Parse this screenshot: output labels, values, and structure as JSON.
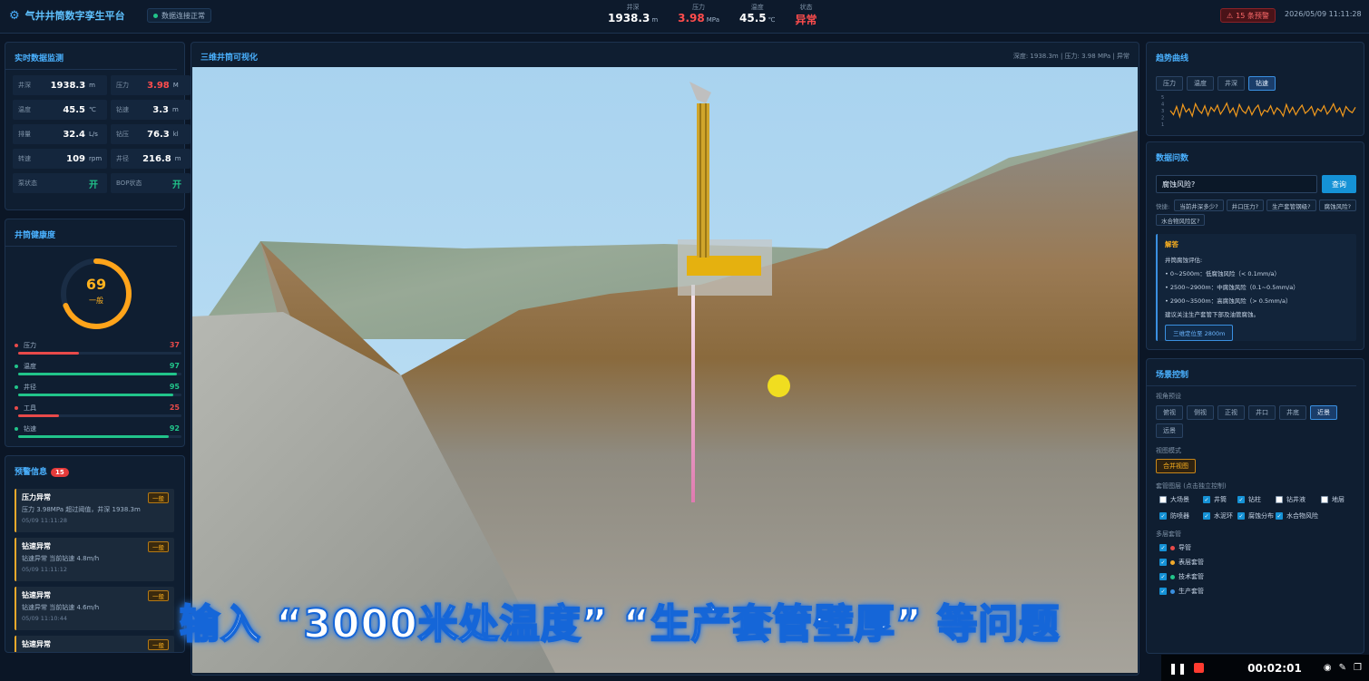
{
  "header": {
    "title": "气井井筒数字孪生平台",
    "connection": "数据连接正常",
    "metrics": [
      {
        "label": "井深",
        "value": "1938.3",
        "unit": "m"
      },
      {
        "label": "压力",
        "value": "3.98",
        "unit": "MPa"
      },
      {
        "label": "温度",
        "value": "45.5",
        "unit": "℃"
      },
      {
        "label": "状态",
        "value": "异常",
        "unit": ""
      }
    ],
    "alarm": "15 条预警",
    "datetime": "2026/05/09 11:11:28"
  },
  "realtime": {
    "title": "实时数据监测",
    "cells": [
      {
        "label": "井深",
        "value": "1938.3",
        "unit": "m"
      },
      {
        "label": "压力",
        "value": "3.98",
        "unit": "M"
      },
      {
        "label": "温度",
        "value": "45.5",
        "unit": "℃"
      },
      {
        "label": "钻速",
        "value": "3.3",
        "unit": "m"
      },
      {
        "label": "排量",
        "value": "32.4",
        "unit": "L/s"
      },
      {
        "label": "钻压",
        "value": "76.3",
        "unit": "kl"
      },
      {
        "label": "转速",
        "value": "109",
        "unit": "rpm"
      },
      {
        "label": "井径",
        "value": "216.8",
        "unit": "m"
      },
      {
        "label": "泵状态",
        "value": "开",
        "unit": ""
      },
      {
        "label": "BOP状态",
        "value": "开",
        "unit": ""
      }
    ]
  },
  "health": {
    "title": "井筒健康度",
    "score": "69",
    "score_fraction": 0.69,
    "level": "一般",
    "items": [
      {
        "name": "压力",
        "value": "37",
        "fraction": 0.37,
        "color": "#e84a4a"
      },
      {
        "name": "温度",
        "value": "97",
        "fraction": 0.97,
        "color": "#21c48a"
      },
      {
        "name": "井径",
        "value": "95",
        "fraction": 0.95,
        "color": "#21c48a"
      },
      {
        "name": "工具",
        "value": "25",
        "fraction": 0.25,
        "color": "#e84a4a"
      },
      {
        "name": "钻速",
        "value": "92",
        "fraction": 0.92,
        "color": "#21c48a"
      }
    ]
  },
  "alerts": {
    "title": "预警信息",
    "count": "15",
    "items": [
      {
        "title": "压力异常",
        "level": "一般",
        "desc": "压力 3.98MPa 超过阈值，井深 1938.3m",
        "time": "05/09 11:11:28"
      },
      {
        "title": "钻速异常",
        "level": "一般",
        "desc": "钻速异常 当前钻速 4.8m/h",
        "time": "05/09 11:11:12"
      },
      {
        "title": "钻速异常",
        "level": "一般",
        "desc": "钻速异常 当前钻速 4.6m/h",
        "time": "05/09 11:10:44"
      },
      {
        "title": "钻速异常",
        "level": "一般",
        "desc": "",
        "time": ""
      }
    ]
  },
  "viewer": {
    "title": "三维井筒可视化",
    "status": "深度: 1938.3m | 压力: 3.98 MPa | 异常"
  },
  "trend": {
    "title": "趋势曲线",
    "tabs": [
      "压力",
      "温度",
      "井深",
      "钻速"
    ],
    "active": "钻速",
    "yticks": [
      "5",
      "4",
      "3",
      "2",
      "1"
    ],
    "series": [
      3.0,
      2.4,
      3.6,
      2.1,
      3.9,
      2.8,
      3.3,
      2.2,
      4.0,
      3.1,
      2.6,
      3.7,
      2.3,
      3.5,
      2.9,
      3.8,
      2.5,
      3.2,
      4.1,
      2.7,
      3.4,
      2.2,
      3.9,
      3.0,
      2.6,
      3.6,
      2.4,
      3.3,
      3.8,
      2.3,
      3.1,
      2.8,
      3.7,
      2.5,
      3.4,
      3.0,
      2.2,
      3.9,
      2.7,
      3.5,
      2.4,
      3.2,
      3.8,
      2.6,
      3.0,
      3.6,
      2.3,
      3.3,
      2.9,
      3.7,
      2.5,
      3.1,
      4.0,
      2.8,
      3.4,
      2.2,
      3.6,
      3.0,
      2.7,
      3.5
    ]
  },
  "qa": {
    "title": "数据问数",
    "input": "腐蚀风险?",
    "button": "查询",
    "quick_label": "快捷:",
    "quick": [
      "当前井深多少?",
      "井口压力?",
      "生产套管钢级?",
      "腐蚀风险?",
      "水合物风险区?"
    ],
    "answer_title": "解答",
    "answer_lines": [
      "井筒腐蚀评估:",
      "• 0~2500m：低腐蚀风险（< 0.1mm/a）",
      "• 2500~2900m：中腐蚀风险（0.1~0.5mm/a）",
      "• 2900~3500m：高腐蚀风险（> 0.5mm/a）",
      "建议关注生产套管下部及油管腐蚀。"
    ],
    "answer_button": "三维定位至 2800m"
  },
  "scene_ctrl": {
    "title": "场景控制",
    "view_label": "视角预设",
    "views": [
      "俯视",
      "侧视",
      "正视",
      "井口",
      "井底",
      "近景",
      "远景"
    ],
    "active_view": "近景",
    "mode_label": "视图模式",
    "mode": "合并视图",
    "layers_label": "套管图层 (点击独立控制)",
    "layers": [
      {
        "name": "大场景",
        "on": false
      },
      {
        "name": "井筒",
        "on": true
      },
      {
        "name": "钻柱",
        "on": true
      },
      {
        "name": "钻井液",
        "on": false
      },
      {
        "name": "地层",
        "on": false
      },
      {
        "name": "防喷器",
        "on": true
      },
      {
        "name": "水泥环",
        "on": true
      },
      {
        "name": "腐蚀分布",
        "on": true
      },
      {
        "name": "水合物风险",
        "on": true
      }
    ],
    "multi_label": "多层套管",
    "multi": [
      {
        "name": "导管",
        "color": "#e84a4a"
      },
      {
        "name": "表层套管",
        "color": "#f0a92b"
      },
      {
        "name": "技术套管",
        "color": "#21c48a"
      },
      {
        "name": "生产套管",
        "color": "#3a8fe0"
      }
    ]
  },
  "overlay": {
    "caption": "输入 “3000米处温度” “生产套管壁厚” 等问题",
    "rec_time": "00:02:01"
  }
}
